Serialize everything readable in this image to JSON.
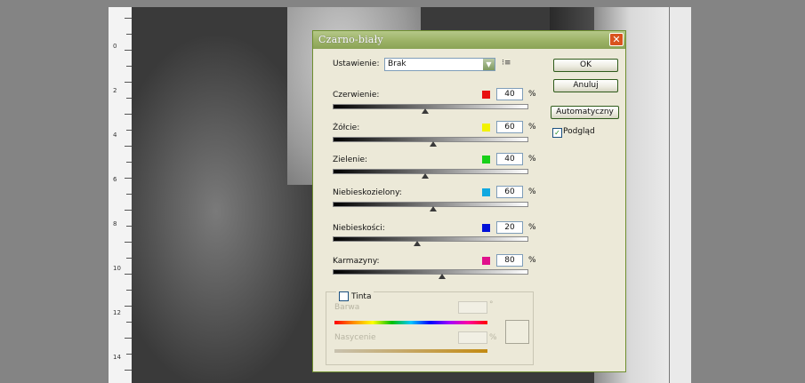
{
  "dialog": {
    "title": "Czarno-biały",
    "close_glyph": "✕",
    "preset_label": "Ustawienie:",
    "preset_value": "Brak",
    "preset_menu_glyph": "⁝≡",
    "buttons": {
      "ok": "OK",
      "cancel": "Anuluj",
      "auto": "Automatyczny"
    },
    "preview": {
      "label": "Podgląd",
      "checked": true,
      "check_glyph": "✓"
    },
    "percent_sign": "%",
    "sliders": [
      {
        "label": "Czerwienie:",
        "value": "40",
        "color": "#e81010"
      },
      {
        "label": "Żółcie:",
        "value": "60",
        "color": "#f2f200"
      },
      {
        "label": "Zielenie:",
        "value": "40",
        "color": "#18d018"
      },
      {
        "label": "Niebieskozielony:",
        "value": "60",
        "color": "#10a8e0"
      },
      {
        "label": "Niebieskości:",
        "value": "20",
        "color": "#0010d8"
      },
      {
        "label": "Karmazyny:",
        "value": "80",
        "color": "#e0108c"
      }
    ],
    "tint": {
      "label": "Tinta",
      "checked": false,
      "hue_label": "Barwa",
      "hue_unit": "°",
      "saturation_label": "Nasycenie",
      "saturation_unit": "%"
    }
  },
  "ruler": {
    "numbers": [
      "0",
      "2",
      "4",
      "6",
      "8",
      "10",
      "12",
      "14"
    ]
  }
}
